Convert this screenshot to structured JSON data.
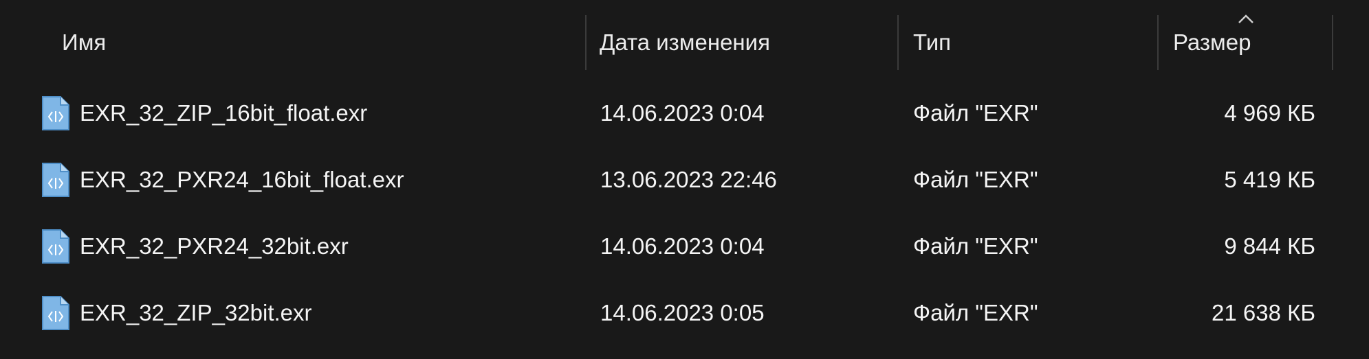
{
  "columns": {
    "name": "Имя",
    "date": "Дата изменения",
    "type": "Тип",
    "size": "Размер"
  },
  "sort": {
    "column": "size",
    "direction": "ascending",
    "icon": "chevron-up-icon"
  },
  "files": [
    {
      "name": "EXR_32_ZIP_16bit_float.exr",
      "date": "14.06.2023 0:04",
      "type": "Файл \"EXR\"",
      "size": "4 969 КБ",
      "icon": "exr-file-icon"
    },
    {
      "name": "EXR_32_PXR24_16bit_float.exr",
      "date": "13.06.2023 22:46",
      "type": "Файл \"EXR\"",
      "size": "5 419 КБ",
      "icon": "exr-file-icon"
    },
    {
      "name": "EXR_32_PXR24_32bit.exr",
      "date": "14.06.2023 0:04",
      "type": "Файл \"EXR\"",
      "size": "9 844 КБ",
      "icon": "exr-file-icon"
    },
    {
      "name": "EXR_32_ZIP_32bit.exr",
      "date": "14.06.2023 0:05",
      "type": "Файл \"EXR\"",
      "size": "21 638 КБ",
      "icon": "exr-file-icon"
    }
  ],
  "colors": {
    "background": "#191919",
    "text": "#f5f5f5",
    "divider": "#3b3b3b",
    "icon": "#6aa9de"
  }
}
